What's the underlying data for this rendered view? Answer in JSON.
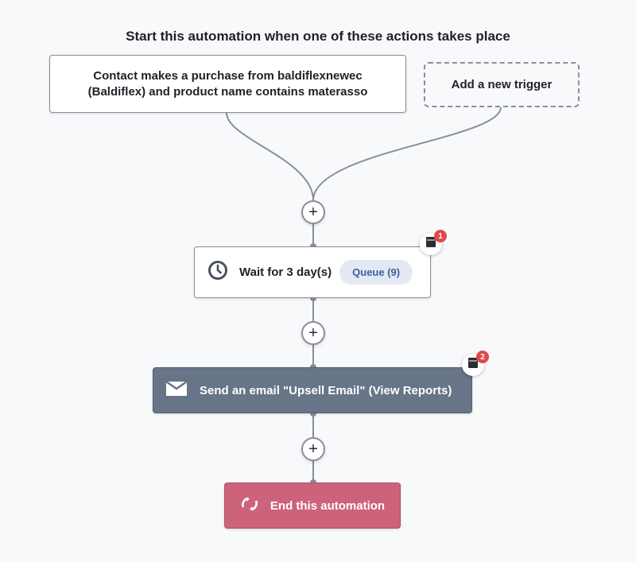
{
  "heading": "Start this automation when one of these actions takes place",
  "triggers": [
    {
      "label": "Contact makes a purchase from baldiflexnewec (Baldiflex) and product name contains materasso"
    }
  ],
  "add_trigger_label": "Add a new trigger",
  "steps": {
    "wait": {
      "label": "Wait for 3 day(s)",
      "queue_label": "Queue (9)",
      "icon": "clock-icon",
      "note_count": "1"
    },
    "email": {
      "label": "Send an email \"Upsell Email\" (View Reports)",
      "icon": "envelope-icon",
      "note_count": "2"
    },
    "end": {
      "label": "End this automation",
      "icon": "refresh-icon"
    }
  },
  "plus_symbol": "+",
  "colors": {
    "connector": "#8a8e99",
    "email_bg": "#687487",
    "end_bg": "#cc637b",
    "queue_bg": "#e3e9f3",
    "badge": "#e0484b"
  }
}
